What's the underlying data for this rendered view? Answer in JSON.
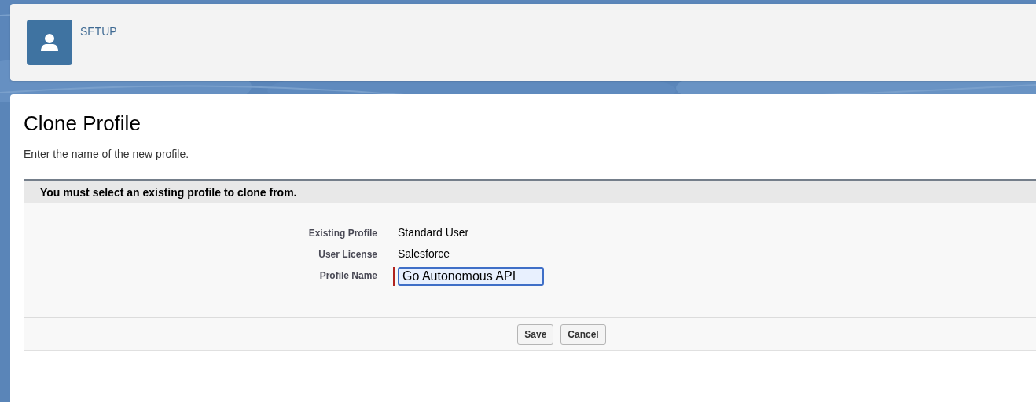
{
  "header": {
    "title": "SETUP"
  },
  "page": {
    "title": "Clone Profile",
    "description": "Enter the name of the new profile."
  },
  "section": {
    "title": "You must select an existing profile to clone from.",
    "fields": [
      {
        "kind": "text",
        "label": "Existing Profile",
        "value": "Standard User"
      },
      {
        "kind": "text",
        "label": "User License",
        "value": "Salesforce"
      },
      {
        "kind": "input",
        "label": "Profile Name",
        "value": "Go Autonomous API",
        "required": true,
        "focused": true
      }
    ],
    "buttons": [
      "Save",
      "Cancel"
    ]
  }
}
